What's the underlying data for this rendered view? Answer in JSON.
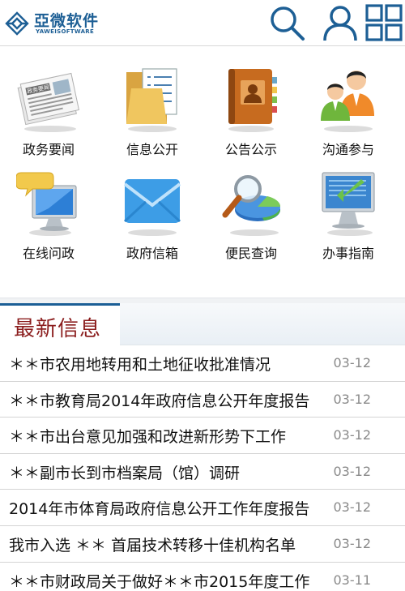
{
  "header": {
    "logo_cn": "亞微软件",
    "logo_en": "YAWEISOFTWARE"
  },
  "menu": [
    {
      "label": "政务要闻",
      "icon": "newspaper-icon"
    },
    {
      "label": "信息公开",
      "icon": "folder-document-icon"
    },
    {
      "label": "公告公示",
      "icon": "address-book-icon"
    },
    {
      "label": "沟通参与",
      "icon": "people-icon"
    },
    {
      "label": "在线问政",
      "icon": "monitor-chat-icon"
    },
    {
      "label": "政府信箱",
      "icon": "envelope-icon"
    },
    {
      "label": "便民查询",
      "icon": "magnifier-chart-icon"
    },
    {
      "label": "办事指南",
      "icon": "monitor-arrow-icon"
    }
  ],
  "news": {
    "title": "最新信息",
    "items": [
      {
        "text": "＊＊市农用地转用和土地征收批准情况",
        "date": "03-12"
      },
      {
        "text": "＊＊市教育局2014年政府信息公开年度报告",
        "date": "03-12"
      },
      {
        "text": "＊＊市出台意见加强和改进新形势下工作",
        "date": "03-12"
      },
      {
        "text": "＊＊副市长到市档案局（馆）调研",
        "date": "03-12"
      },
      {
        "text": "2014年市体育局政府信息公开工作年度报告",
        "date": "03-12"
      },
      {
        "text": "我市入选 ＊＊ 首届技术转移十佳机构名单",
        "date": "03-12"
      },
      {
        "text": "＊＊市财政局关于做好＊＊市2015年度工作",
        "date": "03-11"
      }
    ]
  },
  "colors": {
    "brand_blue": "#1d5f95",
    "title_red": "#8b1d1d",
    "date_gray": "#8a8a8a"
  }
}
